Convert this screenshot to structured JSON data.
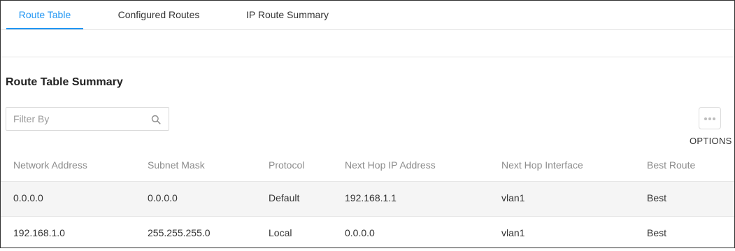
{
  "tabs": [
    {
      "label": "Route Table",
      "active": true
    },
    {
      "label": "Configured Routes",
      "active": false
    },
    {
      "label": "IP Route Summary",
      "active": false
    }
  ],
  "section": {
    "title": "Route Table Summary"
  },
  "filter": {
    "placeholder": "Filter By",
    "value": ""
  },
  "options": {
    "label": "OPTIONS"
  },
  "table": {
    "columns": [
      "Network Address",
      "Subnet Mask",
      "Protocol",
      "Next Hop IP Address",
      "Next Hop Interface",
      "Best Route"
    ],
    "rows": [
      [
        "0.0.0.0",
        "0.0.0.0",
        "Default",
        "192.168.1.1",
        "vlan1",
        "Best"
      ],
      [
        "192.168.1.0",
        "255.255.255.0",
        "Local",
        "0.0.0.0",
        "vlan1",
        "Best"
      ]
    ]
  },
  "colors": {
    "accent": "#2196f3",
    "row_highlight": "#f5f5f5"
  }
}
